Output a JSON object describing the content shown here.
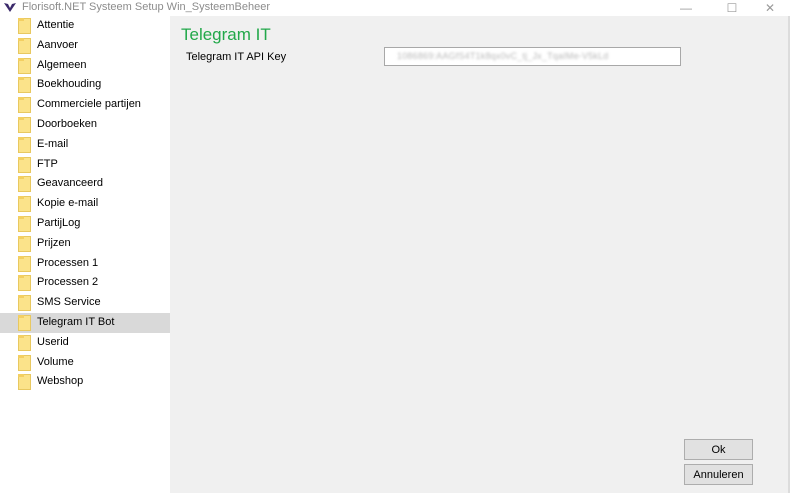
{
  "window": {
    "title": "Florisoft.NET Systeem Setup Win_SysteemBeheer",
    "minimize_glyph": "—",
    "maximize_glyph": "☐",
    "close_glyph": "✕"
  },
  "sidebar": {
    "selected_index": 15,
    "items": [
      {
        "label": "Attentie",
        "icon": "folder-icon"
      },
      {
        "label": "Aanvoer",
        "icon": "folder-icon"
      },
      {
        "label": "Algemeen",
        "icon": "folder-icon"
      },
      {
        "label": "Boekhouding",
        "icon": "folder-icon"
      },
      {
        "label": "Commerciele partijen",
        "icon": "folder-icon"
      },
      {
        "label": "Doorboeken",
        "icon": "folder-icon"
      },
      {
        "label": "E-mail",
        "icon": "folder-icon"
      },
      {
        "label": "FTP",
        "icon": "folder-icon"
      },
      {
        "label": "Geavanceerd",
        "icon": "folder-icon"
      },
      {
        "label": "Kopie e-mail",
        "icon": "folder-icon"
      },
      {
        "label": "PartijLog",
        "icon": "folder-icon"
      },
      {
        "label": "Prijzen",
        "icon": "folder-icon"
      },
      {
        "label": "Processen 1",
        "icon": "folder-icon"
      },
      {
        "label": "Processen 2",
        "icon": "folder-icon"
      },
      {
        "label": "SMS Service",
        "icon": "folder-icon"
      },
      {
        "label": "Telegram IT Bot",
        "icon": "folder-icon"
      },
      {
        "label": "Userid",
        "icon": "folder-icon"
      },
      {
        "label": "Volume",
        "icon": "folder-icon"
      },
      {
        "label": "Webshop",
        "icon": "folder-icon"
      }
    ]
  },
  "main": {
    "title": "Telegram IT",
    "fields": {
      "api_key_label": "Telegram IT API Key",
      "api_key_value": "1086869:AAGfS4T1k8qx0vC_tj_Jx_TqaIMe-V5kLd"
    }
  },
  "buttons": {
    "ok_label": "Ok",
    "cancel_label": "Annuleren"
  },
  "colors": {
    "title_accent": "#22a84a",
    "selected_row": "#d9d9d9",
    "folder": "#fbe38a",
    "logo": "#3b2a6b"
  }
}
